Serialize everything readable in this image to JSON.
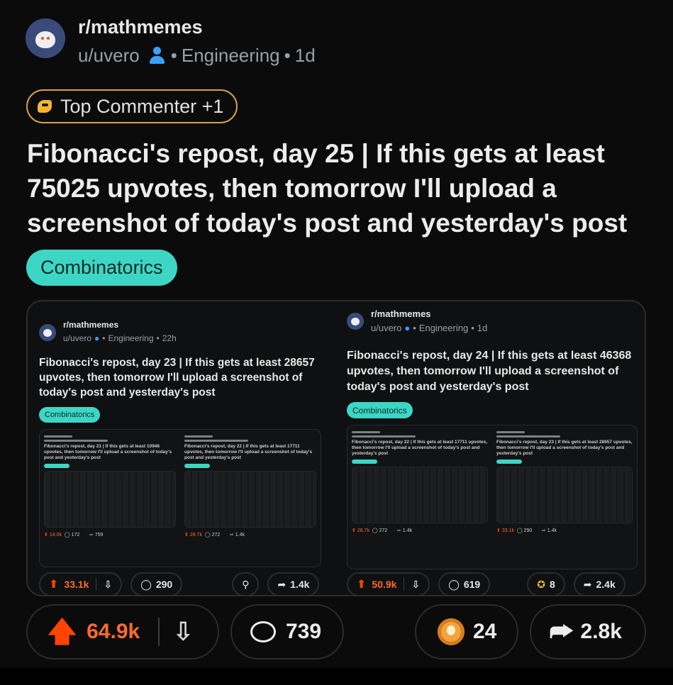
{
  "post": {
    "subreddit": "r/mathmemes",
    "user": "u/uvero",
    "flair_meta": "Engineering",
    "age": "1d",
    "user_flair": "Top Commenter +1",
    "title": "Fibonacci's repost, day 25 | If this gets at least 75025 upvotes, then tomorrow I'll upload a screenshot of today's post and yesterday's post",
    "tag": "Combinatorics",
    "upvotes": "64.9k",
    "comments": "739",
    "awards": "24",
    "shares": "2.8k"
  },
  "embedded": [
    {
      "subreddit": "r/mathmemes",
      "user": "u/uvero",
      "flair_meta": "Engineering",
      "age": "22h",
      "title": "Fibonacci's repost, day 23 | If this gets at least 28657 upvotes, then tomorrow I'll upload a screenshot of today's post and yesterday's post",
      "tag": "Combinatorics",
      "upvotes": "33.1k",
      "comments": "290",
      "shares": "1.4k",
      "mini_posts": [
        {
          "title": "Fibonacci's repost, day 21 | If this gets at least 10946 upvotes, then tomorrow I'll upload a screenshot of today's post and yesterday's post",
          "upvotes": "14.0k",
          "comments": "172",
          "shares": "759"
        },
        {
          "title": "Fibonacci's repost, day 22 | If this gets at least 17711 upvotes, then tomorrow I'll upload a screenshot of today's post and yesterday's post",
          "upvotes": "28.7k",
          "comments": "272",
          "shares": "1.4k"
        }
      ]
    },
    {
      "subreddit": "r/mathmemes",
      "user": "u/uvero",
      "flair_meta": "Engineering",
      "age": "1d",
      "title": "Fibonacci's repost, day 24 | If this gets at least 46368 upvotes, then tomorrow I'll upload a screenshot of today's post and yesterday's post",
      "tag": "Combinatorics",
      "upvotes": "50.9k",
      "comments": "619",
      "awards": "8",
      "shares": "2.4k",
      "mini_posts": [
        {
          "title": "Fibonacci's repost, day 22 | If this gets at least 17711 upvotes, then tomorrow I'll upload a screenshot of today's post and yesterday's post",
          "upvotes": "28.7k",
          "comments": "272",
          "shares": "1.4k"
        },
        {
          "title": "Fibonacci's repost, day 23 | If this gets at least 28657 upvotes, then tomorrow I'll upload a screenshot of today's post and yesterday's post",
          "upvotes": "33.1k",
          "comments": "290",
          "shares": "1.4k"
        }
      ]
    }
  ],
  "icons": [
    "avatar",
    "person-icon",
    "flair-icon",
    "upvote-icon",
    "downvote-icon",
    "comment-icon",
    "award-icon",
    "share-icon"
  ],
  "colors": {
    "accent": "#ff4500",
    "tag": "#3dd6c4",
    "flair_border": "#d2a24a",
    "background": "#0b0b0c"
  }
}
